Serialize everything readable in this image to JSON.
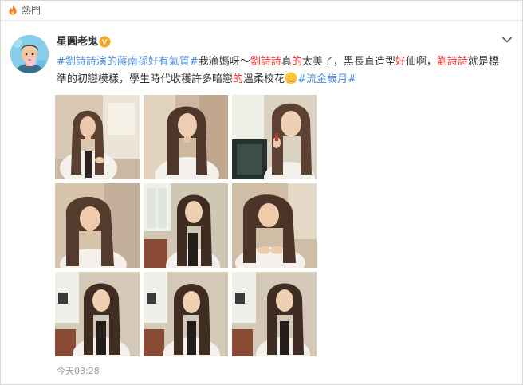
{
  "header": {
    "title": "熱門",
    "icon": "flame-icon"
  },
  "post": {
    "author": "星圓老鬼",
    "badge": "vip-badge-icon",
    "text_parts": [
      {
        "kind": "tag",
        "text": "#劉詩詩演的蔣南孫好有氣質#"
      },
      {
        "kind": "plain",
        "text": "我滴媽呀～"
      },
      {
        "kind": "hl",
        "text": "劉詩詩"
      },
      {
        "kind": "plain",
        "text": "真"
      },
      {
        "kind": "hl",
        "text": "的"
      },
      {
        "kind": "plain",
        "text": "太美了，黑長直造型"
      },
      {
        "kind": "hl",
        "text": "好"
      },
      {
        "kind": "plain",
        "text": "仙啊，"
      },
      {
        "kind": "hl",
        "text": "劉詩詩"
      },
      {
        "kind": "plain",
        "text": "就是標準的初戀模樣，學生時代收穫許多暗戀"
      },
      {
        "kind": "hl",
        "text": "的"
      },
      {
        "kind": "plain",
        "text": "溫柔校花"
      },
      {
        "kind": "emoji",
        "text": "smiling-blush-emoji"
      },
      {
        "kind": "tag",
        "text": "#流金歲月#"
      }
    ],
    "timestamp": "今天08:28",
    "photos_count": 9
  },
  "colors": {
    "link": "#4b8bd6",
    "highlight": "#e8302c",
    "text": "#333333",
    "muted": "#999999",
    "badge": "#f5a623"
  }
}
